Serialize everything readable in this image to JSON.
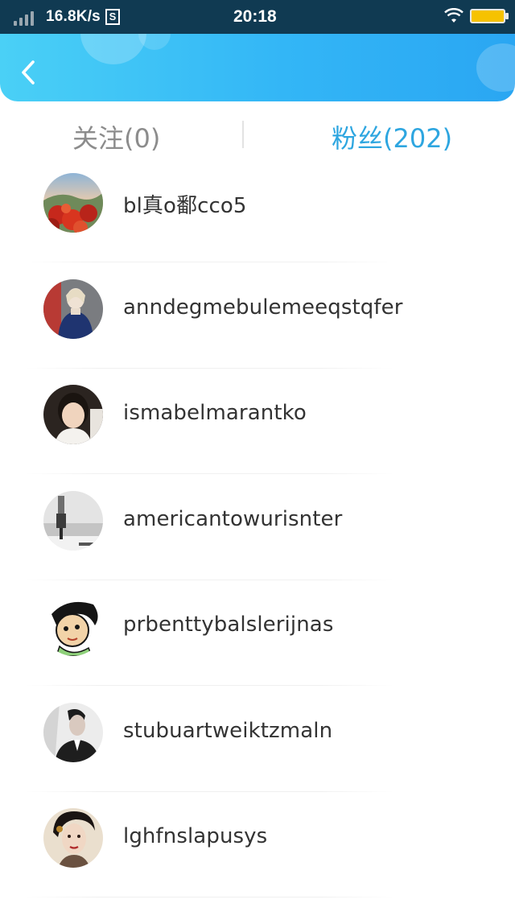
{
  "status_bar": {
    "network_speed": "16.8K/s",
    "sim_badge": "S",
    "time": "20:18",
    "icons": [
      "signal-icon",
      "wifi-icon",
      "battery-icon"
    ]
  },
  "header": {
    "back_icon": "chevron-left-icon",
    "colors": {
      "gradient_start": "#4ad0f6",
      "gradient_end": "#2aa6f2"
    }
  },
  "tabs": [
    {
      "label": "关注(0)",
      "active": false
    },
    {
      "label": "粉丝(202)",
      "active": true
    }
  ],
  "colors": {
    "active_tab": "#2ea6e0",
    "inactive_tab": "#8c8c8c",
    "username": "#333333"
  },
  "fans": [
    {
      "username": "bl真o鄱cco5",
      "avatar": "landscape-red-flowers-avatar"
    },
    {
      "username": "anndegmebulemeeqstqfer",
      "avatar": "blonde-woman-avatar"
    },
    {
      "username": "ismabelmarantko",
      "avatar": "child-portrait-avatar"
    },
    {
      "username": "americantowurisnter",
      "avatar": "monochrome-photo-avatar"
    },
    {
      "username": "prbenttybalslerijnas",
      "avatar": "cartoon-character-avatar"
    },
    {
      "username": "stubuartweiktzmaln",
      "avatar": "man-in-suit-avatar"
    },
    {
      "username": "lghfnslapusys",
      "avatar": "woman-portrait-avatar"
    }
  ]
}
